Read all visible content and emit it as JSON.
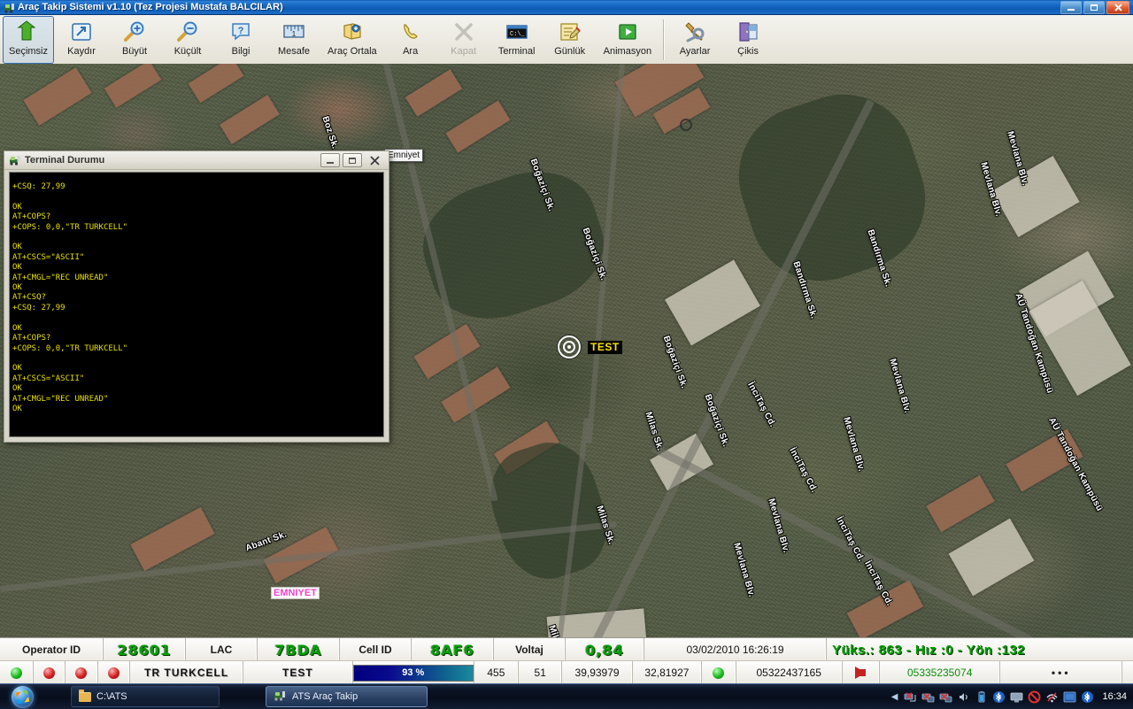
{
  "window": {
    "title": "Araç Takip Sistemi v1.10 (Tez Projesi Mustafa BALCILAR)",
    "icon": "app-icon",
    "minimize": "_",
    "maximize": "❐",
    "close": "✕"
  },
  "toolbar": {
    "items": [
      {
        "label": "Seçimsiz",
        "icon": "arrow-cursor-icon",
        "state": "active"
      },
      {
        "label": "Kaydır",
        "icon": "pan-icon",
        "state": "normal"
      },
      {
        "label": "Büyüt",
        "icon": "zoom-in-icon",
        "state": "normal"
      },
      {
        "label": "Küçült",
        "icon": "zoom-out-icon",
        "state": "normal"
      },
      {
        "label": "Bilgi",
        "icon": "info-icon",
        "state": "normal"
      },
      {
        "label": "Mesafe",
        "icon": "ruler-icon",
        "state": "normal"
      },
      {
        "label": "Araç Ortala",
        "icon": "center-vehicle-icon",
        "state": "normal"
      },
      {
        "label": "Ara",
        "icon": "phone-icon",
        "state": "normal"
      },
      {
        "label": "Kapat",
        "icon": "hangup-icon",
        "state": "disabled"
      },
      {
        "label": "Terminal",
        "icon": "terminal-icon",
        "state": "normal"
      },
      {
        "label": "Günlük",
        "icon": "log-icon",
        "state": "normal"
      },
      {
        "label": "Animasyon",
        "icon": "play-icon",
        "state": "normal"
      },
      {
        "label": "Ayarlar",
        "icon": "tools-icon",
        "state": "normal"
      },
      {
        "label": "Çikis",
        "icon": "exit-icon",
        "state": "normal"
      }
    ]
  },
  "terminal_window": {
    "title": "Terminal Durumu",
    "icon": "terminal-window-icon",
    "minimize": "_",
    "restore": "❐",
    "close": "✕",
    "content": "+CSQ: 27,99\n\nOK\nAT+COPS?\n+COPS: 0,0,\"TR TURKCELL\"\n\nOK\nAT+CSCS=\"ASCII\"\nOK\nAT+CMGL=\"REC UNREAD\"\nOK\nAT+CSQ?\n+CSQ: 27,99\n\nOK\nAT+COPS?\n+COPS: 0,0,\"TR TURKCELL\"\n\nOK\nAT+CSCS=\"ASCII\"\nOK\nAT+CMGL=\"REC UNREAD\"\nOK",
    "text_color": "#e8e000",
    "background": "#000000"
  },
  "map": {
    "marker_label": "TEST",
    "pois": [
      {
        "name": "Emniyet",
        "type": "box"
      },
      {
        "name": "EMNIYET",
        "type": "pink"
      }
    ],
    "streets": [
      "Boğaziçi Sk.",
      "Boğaziçi Sk.",
      "Boğaziçi Sk.",
      "Boğaziçi Sk.",
      "Milas Sk.",
      "Milas Sk.",
      "Milas Sk.",
      "Bandırma Sk.",
      "Bandırma Sk.",
      "Mevlana Blv.",
      "Mevlana Blv.",
      "Mevlana Blv.",
      "Mevlana Blv.",
      "Mevlana Blv.",
      "Mevlana Blv.",
      "İnciTaş Cd.",
      "İnciTaş Cd.",
      "İnciTaş Cd.",
      "İnciTaş Cd.",
      "AÜ Tandoğan Kampüsü",
      "AÜ Tandoğan Kampüsü",
      "Abant Sk.",
      "Boz Sk."
    ]
  },
  "status_bar": {
    "operator_id_label": "Operator ID",
    "operator_id_value": "28601",
    "lac_label": "LAC",
    "lac_value": "7BDA",
    "cell_id_label": "Cell ID",
    "cell_id_value": "8AF6",
    "voltaj_label": "Voltaj",
    "voltaj_value": "0,84",
    "datetime": "03/02/2010 16:26:19",
    "gps_info": "Yüks.: 863  -  Hız :0  -  Yön :132",
    "value_color": "#00a000"
  },
  "status_bar2": {
    "leds": [
      "green",
      "red",
      "red",
      "red"
    ],
    "operator_name": "TR TURKCELL",
    "vehicle_name": "TEST",
    "signal_percent": "93 %",
    "signal_value": 93,
    "num1": "455",
    "num2": "51",
    "latitude": "39,93979",
    "longitude": "32,81927",
    "gps_led": "green",
    "phone_primary": "05322437165",
    "arrow_icon": "red-arrow-icon",
    "phone_secondary": "05335235074",
    "dots": "•••"
  },
  "taskbar": {
    "start_icon": "windows-start-orb",
    "items": [
      {
        "label": "C:\\ATS",
        "icon": "folder-icon",
        "active": false
      },
      {
        "label": "ATS Araç Takip",
        "icon": "app-icon",
        "active": true
      }
    ],
    "tray_icons": [
      "show-hidden-arrow",
      "network-disconnected-icon",
      "network-disconnected-icon",
      "network-disconnected-icon",
      "sound-icon",
      "battery-icon",
      "bluetooth-icon",
      "monitor-icon",
      "blocked-icon",
      "wireless-icon",
      "display-icon",
      "bluetooth-icon"
    ],
    "clock": "16:34"
  }
}
